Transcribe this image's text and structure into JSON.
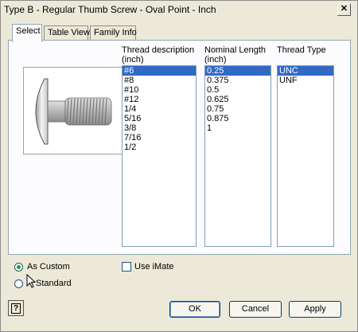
{
  "window": {
    "title": "Type B - Regular Thumb Screw - Oval Point - Inch",
    "close_glyph": "✕"
  },
  "tabs": [
    {
      "label": "Select",
      "active": true
    },
    {
      "label": "Table View",
      "active": false
    },
    {
      "label": "Family Info",
      "active": false
    }
  ],
  "preview": {
    "icon": "thumb-screw-oval-point-image"
  },
  "columns": {
    "thread_description": {
      "label_line1": "Thread description",
      "label_line2": "(inch)",
      "items": [
        "#6",
        "#8",
        "#10",
        "#12",
        "1/4",
        "5/16",
        "3/8",
        "7/16",
        "1/2"
      ],
      "selected": "#6"
    },
    "nominal_length": {
      "label_line1": "Nominal Length",
      "label_line2": "(inch)",
      "items": [
        "0.25",
        "0.375",
        "0.5",
        "0.625",
        "0.75",
        "0.875",
        "1"
      ],
      "selected": "0.25"
    },
    "thread_type": {
      "label_line1": "Thread Type",
      "items": [
        "UNC",
        "UNF"
      ],
      "selected": "UNC"
    }
  },
  "options": {
    "as_custom": {
      "label": "As Custom",
      "checked": true
    },
    "standard": {
      "label": "Standard",
      "checked": false
    },
    "use_imate": {
      "label": "Use iMate",
      "checked": false
    }
  },
  "buttons": {
    "ok": "OK",
    "cancel": "Cancel",
    "apply": "Apply",
    "help": "?"
  }
}
